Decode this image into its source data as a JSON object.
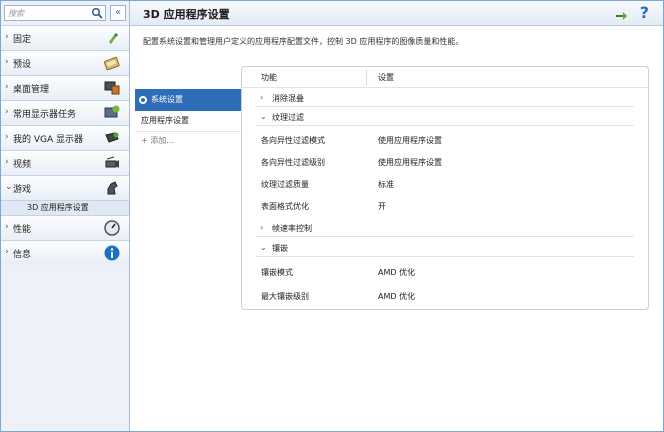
{
  "sidebar": {
    "search_placeholder": "搜索",
    "collapse_label": "«",
    "items": [
      {
        "label": "固定",
        "chev": "›"
      },
      {
        "label": "预设",
        "chev": "›"
      },
      {
        "label": "桌面管理",
        "chev": "›"
      },
      {
        "label": "常用显示器任务",
        "chev": "›"
      },
      {
        "label": "我的 VGA 显示器",
        "chev": "›"
      },
      {
        "label": "视频",
        "chev": "›"
      },
      {
        "label": "游戏",
        "chev": "⌄"
      },
      {
        "label": "性能",
        "chev": "›"
      },
      {
        "label": "信息",
        "chev": "›"
      }
    ],
    "sub_item": "3D 应用程序设置"
  },
  "header": {
    "title": "3D 应用程序设置",
    "help": "?"
  },
  "description": "配置系统设置和管理用户定义的应用程序配置文件，控制 3D 应用程序的图像质量和性能。",
  "tree": {
    "selected": "系统设置",
    "item": "应用程序设置",
    "add": "+ 添加..."
  },
  "table": {
    "col_feature": "功能",
    "col_setting": "设置",
    "groups": {
      "aa": "消除混叠",
      "tex": "纹理过滤",
      "frc": "帧速率控制",
      "tess": "镶嵌"
    },
    "rows": {
      "r1": {
        "k": "各向异性过滤模式",
        "v": "使用应用程序设置"
      },
      "r2": {
        "k": "各向异性过滤级别",
        "v": "使用应用程序设置"
      },
      "r3": {
        "k": "纹理过滤质量",
        "v": "标准"
      },
      "r4": {
        "k": "表面格式优化",
        "v": "开"
      },
      "r5": {
        "k": "镶嵌模式",
        "v": "AMD 优化"
      },
      "r6": {
        "k": "最大镶嵌级别",
        "v": "AMD 优化"
      }
    },
    "arrows": {
      "collapsed": "›",
      "expanded": "⌄"
    }
  },
  "colors": {
    "accent": "#2e6db8",
    "border": "#7aa7d6"
  }
}
